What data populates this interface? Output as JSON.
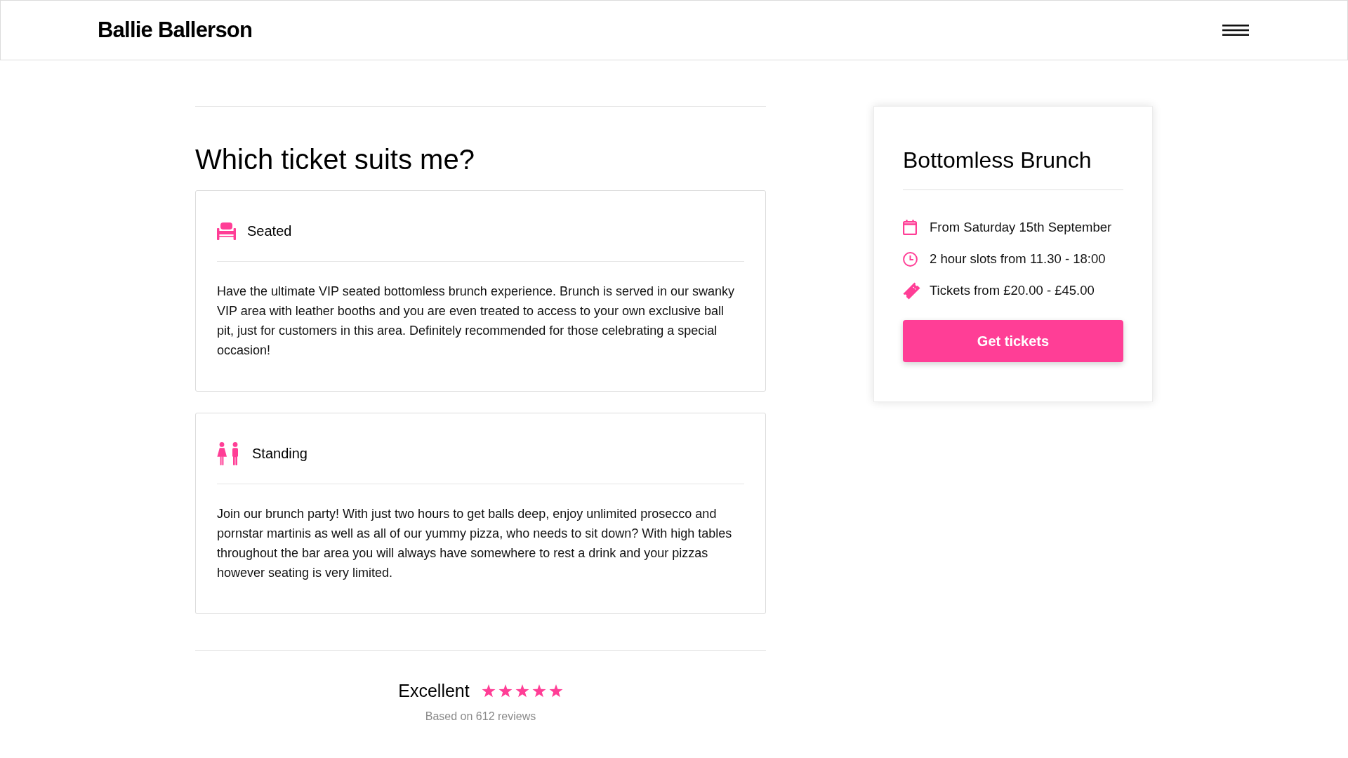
{
  "header": {
    "logo": "Ballie Ballerson"
  },
  "main": {
    "heading": "Which ticket suits me?",
    "tickets": [
      {
        "kind": "seated",
        "title": "Seated",
        "description": "Have the ultimate VIP seated bottomless brunch experience. Brunch is served in our swanky VIP area with leather booths and you are even treated to access to your own exclusive ball pit, just for customers in this area. Definitely recommended for those celebrating a special occasion!"
      },
      {
        "kind": "standing",
        "title": "Standing",
        "description": "Join our brunch party! With just two hours to get balls deep, enjoy unlimited prosecco and pornstar martinis as well as all of our yummy pizza, who needs to sit down? With high tables throughout the bar area you will always have somewhere to rest a drink and your pizzas however seating is very limited."
      }
    ],
    "rating": {
      "label": "Excellent",
      "stars": 5,
      "reviews": "Based on 612 reviews"
    }
  },
  "event_card": {
    "title": "Bottomless Brunch",
    "details": [
      {
        "kind": "date",
        "text": "From Saturday 15th September"
      },
      {
        "kind": "time",
        "text": "2 hour slots from 11.30 - 18:00"
      },
      {
        "kind": "price",
        "text": "Tickets from £20.00 - £45.00"
      }
    ],
    "button": "Get tickets"
  }
}
